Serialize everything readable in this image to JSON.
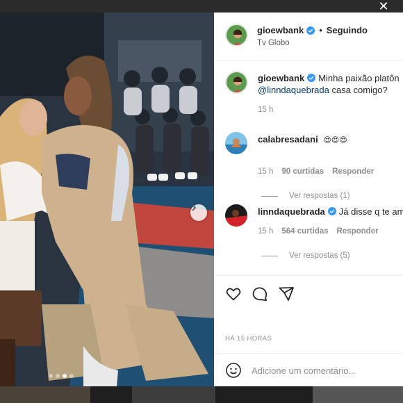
{
  "window": {
    "close_glyph": "✕"
  },
  "post": {
    "author": {
      "username": "gioewbank",
      "verified": true,
      "follow_state": "Seguindo",
      "separator": "•",
      "location": "Tv Globo"
    },
    "caption": {
      "username": "gioewbank",
      "text": "Minha paixão platôn",
      "mention": "@linndaquebrada",
      "text_after": "casa comigo?",
      "time": "15 h"
    },
    "comments": [
      {
        "username": "calabresadani",
        "verified": false,
        "text": "😍😍😍",
        "time": "15 h",
        "likes": "90 curtidas",
        "reply_label": "Responder",
        "view_replies": "Ver respostas (1)"
      },
      {
        "username": "linndaquebrada",
        "verified": true,
        "text": "Já disse q te am",
        "time": "15 h",
        "likes": "564 curtidas",
        "reply_label": "Responder",
        "view_replies": "Ver respostas (5)"
      }
    ],
    "time_ago": "HÁ 15 HORAS",
    "add_comment": {
      "placeholder": "Adicione um comentário..."
    },
    "carousel": {
      "total": 4,
      "active_index": 2
    }
  },
  "icons": {
    "verified": "verified-badge-icon",
    "like": "heart-icon",
    "comment": "comment-bubble-icon",
    "share": "paper-plane-icon",
    "emoji": "smiley-icon",
    "next": "chevron-right-icon",
    "close": "close-icon"
  },
  "colors": {
    "verified": "#3897f0",
    "mention": "#00376b",
    "muted": "#8e8e8e",
    "text": "#262626"
  }
}
